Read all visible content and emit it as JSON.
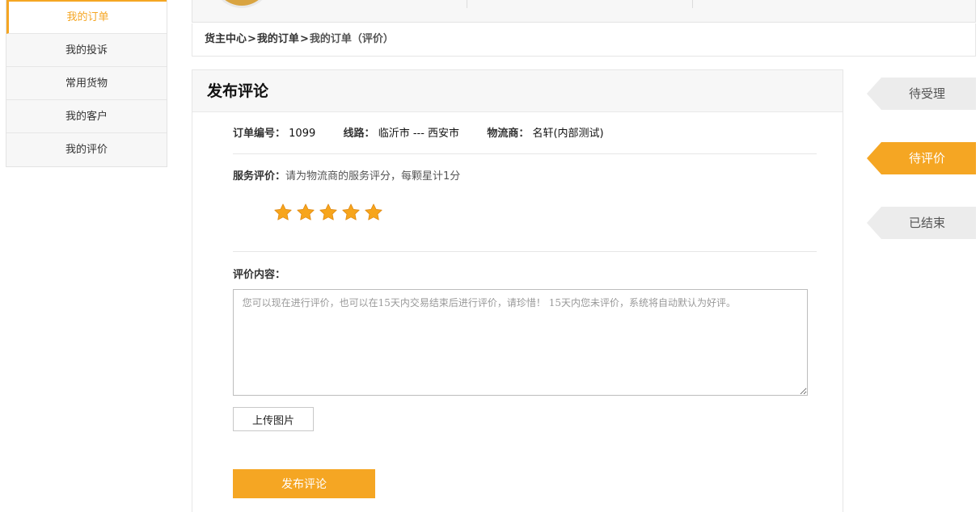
{
  "sidebar": {
    "items": [
      {
        "label": "我的订单"
      },
      {
        "label": "我的投诉"
      },
      {
        "label": "常用货物"
      },
      {
        "label": "我的客户"
      },
      {
        "label": "我的评价"
      }
    ]
  },
  "breadcrumb": {
    "home": "货主中心",
    "sep": ">",
    "level2": "我的订单",
    "current": "我的订单（评价）"
  },
  "panel": {
    "title": "发布评论",
    "order_no_label": "订单编号：",
    "order_no": "1099",
    "route_label": "线路：",
    "route": "临沂市 --- 西安市",
    "carrier_label": "物流商：",
    "carrier": "名轩(内部测试)",
    "service_label": "服务评价：",
    "service_hint": "请为物流商的服务评分，每颗星计1分",
    "rating": 5,
    "rating_max": 5,
    "content_label": "评价内容：",
    "content_placeholder": "  您可以现在进行评价，也可以在15天内交易结束后进行评价，请珍惜！ 15天内您未评价，系统将自动默认为好评。",
    "upload_label": "上传图片",
    "submit_label": "发布评论"
  },
  "status_tabs": [
    {
      "label": "待受理",
      "active": false
    },
    {
      "label": "待评价",
      "active": true
    },
    {
      "label": "已结束",
      "active": false
    }
  ],
  "colors": {
    "accent": "#f5a623",
    "tab_inactive": "#ececec",
    "star": "#f7a51c"
  }
}
